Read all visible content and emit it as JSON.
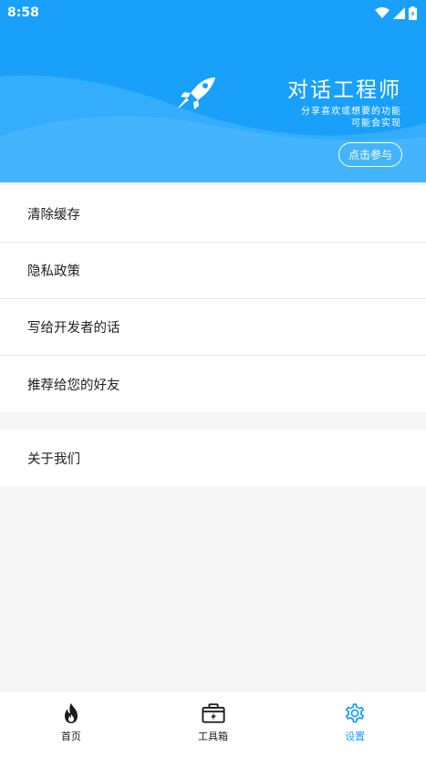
{
  "status_bar": {
    "time": "8:58"
  },
  "banner": {
    "title": "对话工程师",
    "subtitle_line1": "分享喜欢或想要的功能",
    "subtitle_line2": "可能会实现",
    "join_label": "点击参与",
    "color": "#18a0fb"
  },
  "menu": {
    "group1": [
      {
        "label": "清除缓存"
      },
      {
        "label": "隐私政策"
      },
      {
        "label": "写给开发者的话"
      },
      {
        "label": "推荐给您的好友"
      }
    ],
    "group2": [
      {
        "label": "关于我们"
      }
    ]
  },
  "bottom_nav": {
    "tabs": [
      {
        "label": "首页",
        "icon": "flame-icon"
      },
      {
        "label": "工具箱",
        "icon": "toolbox-icon"
      },
      {
        "label": "设置",
        "icon": "gear-icon",
        "active": true
      }
    ],
    "active_color": "#18a0fb"
  }
}
